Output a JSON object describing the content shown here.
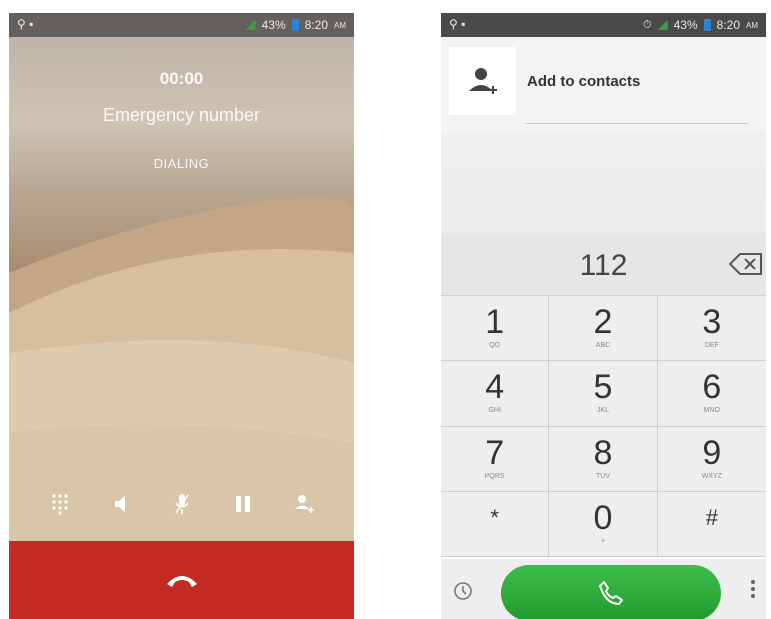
{
  "call_screen": {
    "status_bar": {
      "battery": "43%",
      "time": "8:20",
      "ampm": "AM"
    },
    "timer": "00:00",
    "caller": "Emergency number",
    "state": "DIALING",
    "controls": [
      "dialpad-icon",
      "speaker-icon",
      "mute-icon",
      "hold-icon",
      "add-call-icon"
    ]
  },
  "dialer": {
    "status_bar": {
      "battery": "43%",
      "time": "8:20",
      "ampm": "AM"
    },
    "add_contact": "Add to contacts",
    "number": "112",
    "keys": [
      {
        "digit": "1",
        "letters": "QO"
      },
      {
        "digit": "2",
        "letters": "ABC"
      },
      {
        "digit": "3",
        "letters": "DEF"
      },
      {
        "digit": "4",
        "letters": "GHI"
      },
      {
        "digit": "5",
        "letters": "JKL"
      },
      {
        "digit": "6",
        "letters": "MNO"
      },
      {
        "digit": "7",
        "letters": "PQRS"
      },
      {
        "digit": "8",
        "letters": "TUV"
      },
      {
        "digit": "9",
        "letters": "WXYZ"
      },
      {
        "digit": "*",
        "letters": ""
      },
      {
        "digit": "0",
        "letters": "+"
      },
      {
        "digit": "#",
        "letters": ""
      }
    ]
  },
  "colors": {
    "end_call": "#c42a23",
    "call_green": "#2ea83b"
  }
}
